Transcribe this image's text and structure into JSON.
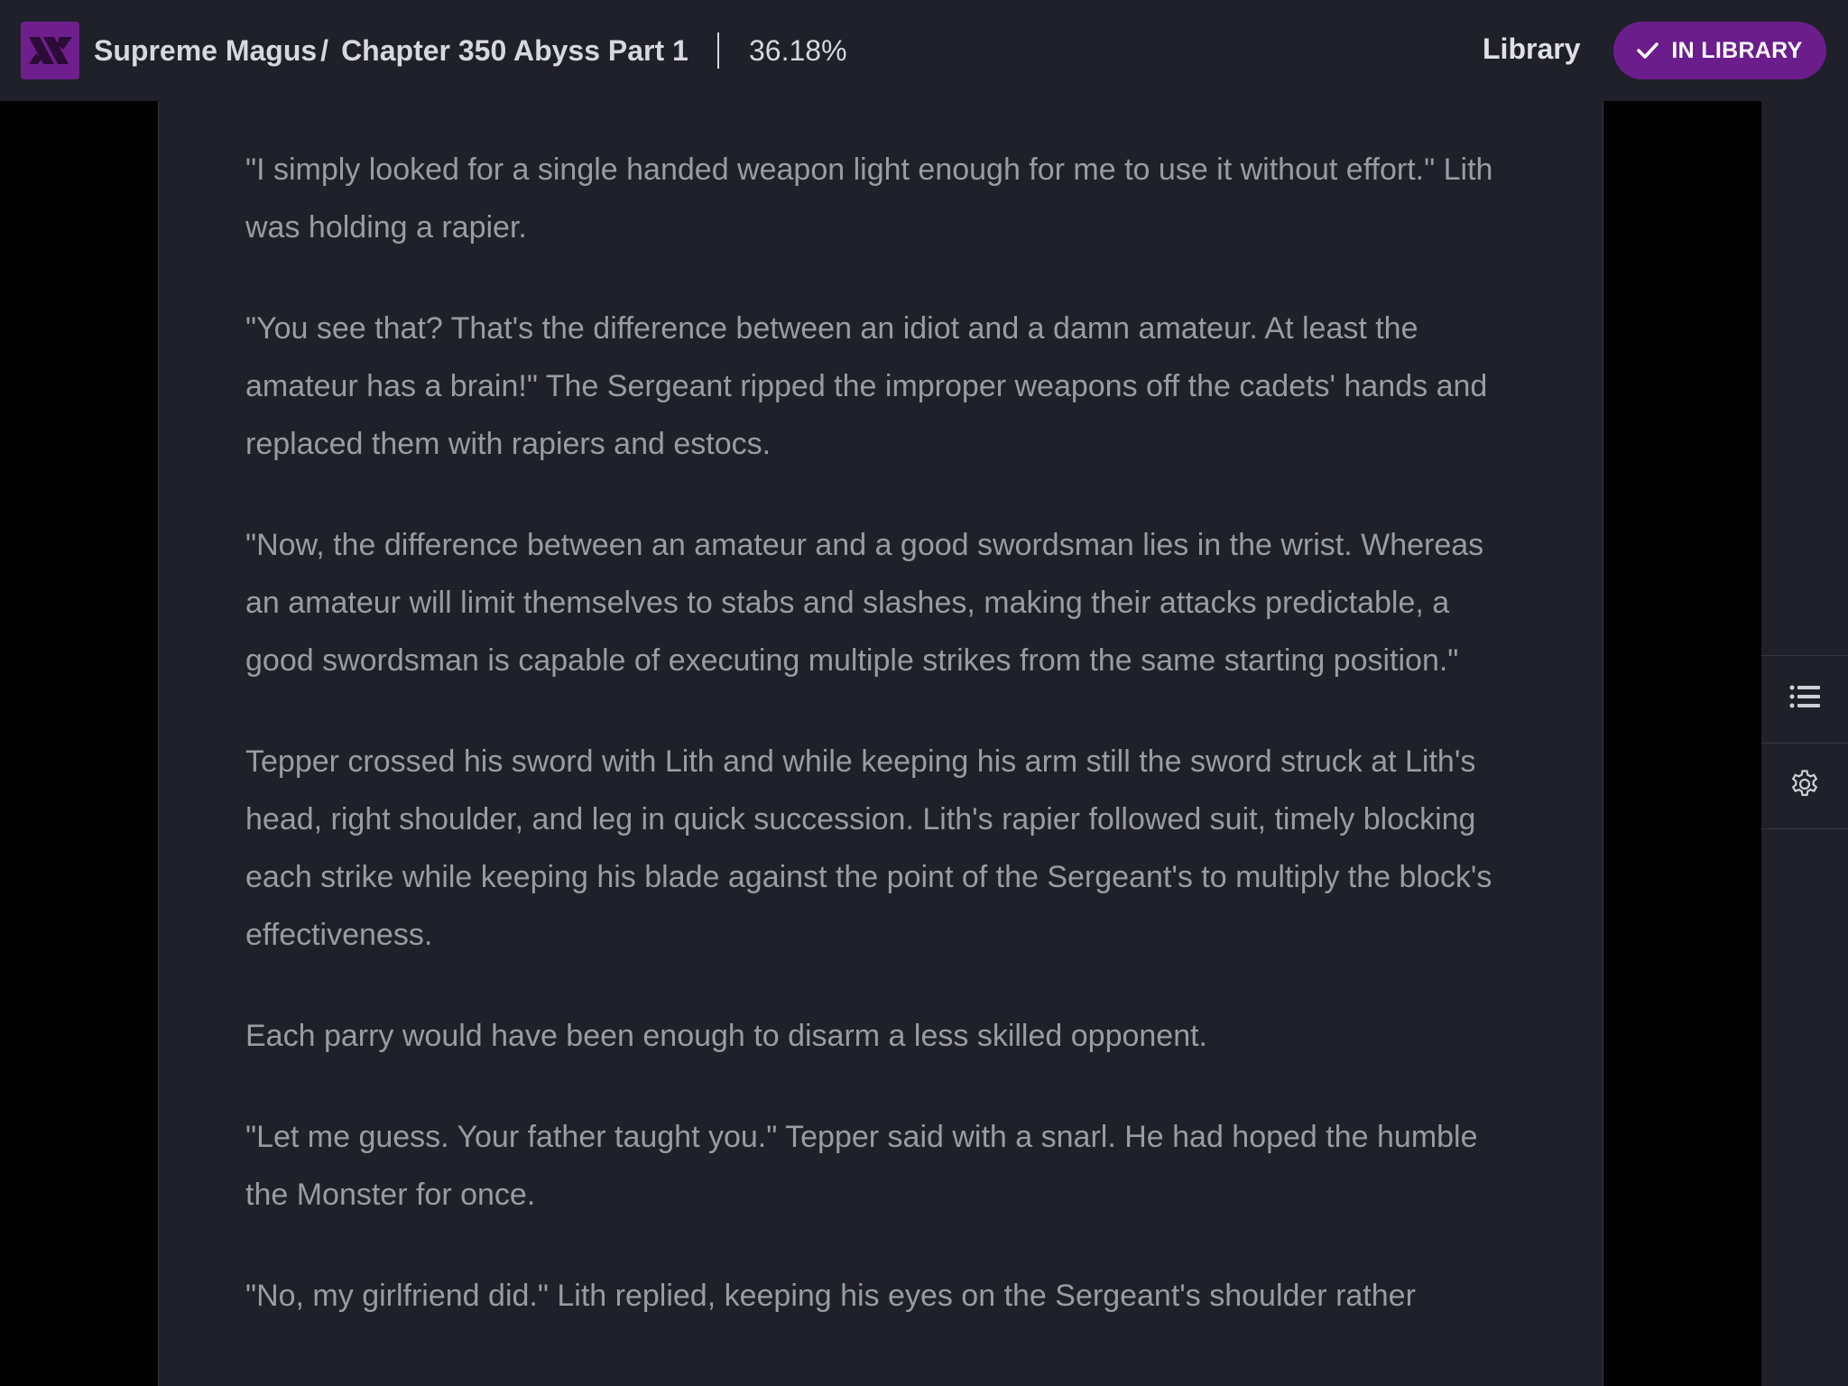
{
  "header": {
    "series_title": "Supreme Magus",
    "separator": "/",
    "chapter_title": "Chapter 350 Abyss Part 1",
    "progress": "36.18%",
    "library_link": "Library",
    "in_library_button": "IN LIBRARY"
  },
  "colors": {
    "accent": "#6b1d8c",
    "background": "#1f2029",
    "text": "#9a9ba3"
  },
  "icons": {
    "logo": "site-logo",
    "check": "check-icon",
    "toc": "list-icon",
    "settings": "gear-icon"
  },
  "chapter": {
    "paragraphs": [
      "\"I simply looked for a single handed weapon light enough for me to use it without effort.\" Lith was holding a rapier.",
      "\"You see that? That's the difference between an idiot and a damn amateur. At least the amateur has a brain!\" The Sergeant ripped the improper weapons off the cadets' hands and replaced them with rapiers and estocs.",
      "\"Now, the difference between an amateur and a good swordsman lies in the wrist. Whereas an amateur will limit themselves to stabs and slashes, making their attacks predictable, a good swordsman is capable of executing multiple strikes from the same starting position.\"",
      "Tepper crossed his sword with Lith and while keeping his arm still the sword struck at Lith's head, right shoulder, and leg in quick succession. Lith's rapier followed suit, timely blocking each strike while keeping his blade against the point of the Sergeant's to multiply the block's effectiveness.",
      "Each parry would have been enough to disarm a less skilled opponent.",
      "\"Let me guess. Your father taught you.\" Tepper said with a snarl. He had hoped the humble the Monster for once.",
      "\"No, my girlfriend did.\" Lith replied, keeping his eyes on the Sergeant's shoulder rather"
    ]
  }
}
